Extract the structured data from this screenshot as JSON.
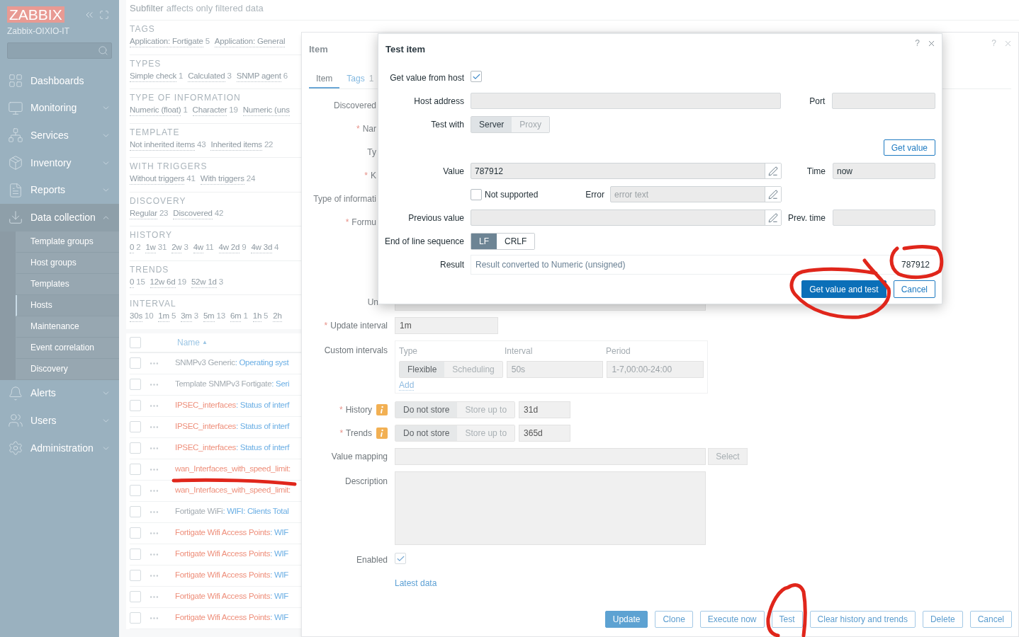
{
  "sidebar": {
    "logo": "ZABBIX",
    "server": "Zabbix-OIXIO-IT",
    "menu": [
      {
        "label": "Dashboards"
      },
      {
        "label": "Monitoring",
        "expanded": false
      },
      {
        "label": "Services",
        "expanded": false
      },
      {
        "label": "Inventory",
        "expanded": false
      },
      {
        "label": "Reports",
        "expanded": false
      },
      {
        "label": "Data collection",
        "expanded": true,
        "children": [
          {
            "label": "Template groups",
            "selected": false
          },
          {
            "label": "Host groups",
            "selected": false
          },
          {
            "label": "Templates",
            "selected": false
          },
          {
            "label": "Hosts",
            "selected": true
          },
          {
            "label": "Maintenance",
            "selected": false
          },
          {
            "label": "Event correlation",
            "selected": false
          },
          {
            "label": "Discovery",
            "selected": false
          }
        ]
      },
      {
        "label": "Alerts",
        "expanded": false
      },
      {
        "label": "Users",
        "expanded": false
      },
      {
        "label": "Administration",
        "expanded": false
      }
    ]
  },
  "subfilter": {
    "label": "Subfilter",
    "note": "affects only filtered data",
    "groups": [
      {
        "title": "TAGS",
        "items": [
          {
            "label": "Application: Fortigate",
            "count": "5"
          },
          {
            "label": "Application: General"
          }
        ]
      },
      {
        "title": "TYPES",
        "items": [
          {
            "label": "Simple check",
            "count": "1"
          },
          {
            "label": "Calculated",
            "count": "3"
          },
          {
            "label": "SNMP agent",
            "count": "6"
          }
        ]
      },
      {
        "title": "TYPE OF INFORMATION",
        "items": [
          {
            "label": "Numeric (float)",
            "count": "1"
          },
          {
            "label": "Character",
            "count": "19"
          },
          {
            "label": "Numeric (uns"
          }
        ]
      },
      {
        "title": "TEMPLATE",
        "items": [
          {
            "label": "Not inherited items",
            "count": "43"
          },
          {
            "label": "Inherited items",
            "count": "22"
          }
        ]
      },
      {
        "title": "WITH TRIGGERS",
        "items": [
          {
            "label": "Without triggers",
            "count": "41"
          },
          {
            "label": "With triggers",
            "count": "24"
          }
        ]
      },
      {
        "title": "DISCOVERY",
        "items": [
          {
            "label": "Regular",
            "count": "23"
          },
          {
            "label": "Discovered",
            "count": "42"
          }
        ]
      },
      {
        "title": "HISTORY",
        "items": [
          {
            "label": "0",
            "count": "2"
          },
          {
            "label": "1w",
            "count": "31"
          },
          {
            "label": "2w",
            "count": "3"
          },
          {
            "label": "4w",
            "count": "11"
          },
          {
            "label": "4w 2d",
            "count": "9"
          },
          {
            "label": "4w 3d",
            "count": "4"
          }
        ]
      },
      {
        "title": "TRENDS",
        "items": [
          {
            "label": "0",
            "count": "15"
          },
          {
            "label": "12w 6d",
            "count": "19"
          },
          {
            "label": "52w 1d",
            "count": "3"
          }
        ]
      },
      {
        "title": "INTERVAL",
        "items": [
          {
            "label": "30s",
            "count": "10"
          },
          {
            "label": "1m",
            "count": "5"
          },
          {
            "label": "3m",
            "count": "3"
          },
          {
            "label": "5m",
            "count": "13"
          },
          {
            "label": "6m",
            "count": "1"
          },
          {
            "label": "1h",
            "count": "5"
          },
          {
            "label": "2h"
          }
        ]
      }
    ]
  },
  "items_table": {
    "header": {
      "label": "Name",
      "sort_mark": "▲",
      "checked": false
    },
    "rows": [
      {
        "kind": "template",
        "host": "SNMPv3 Generic",
        "name": ": Operating syst",
        "checked": false
      },
      {
        "kind": "template",
        "host": "Template SNMPv3 Fortigate",
        "name": ": Seri",
        "checked": false
      },
      {
        "kind": "discovered",
        "host": "IPSEC_interfaces",
        "name": ": Status of interf",
        "checked": false
      },
      {
        "kind": "discovered",
        "host": "IPSEC_interfaces",
        "name": ": Status of interf",
        "checked": false
      },
      {
        "kind": "discovered",
        "host": "IPSEC_interfaces",
        "name": ": Status of interf",
        "checked": false
      },
      {
        "kind": "discovered",
        "host": "wan_Interfaces_with_speed_limit:",
        "checked": false
      },
      {
        "kind": "discovered",
        "host": "wan_Interfaces_with_speed_limit:",
        "checked": false
      },
      {
        "kind": "template",
        "host": "Fortigate WiFi",
        "name": ": WIFI: Clients Total",
        "checked": false
      },
      {
        "kind": "discovered",
        "host": "Fortigate Wifi Access Points",
        "name": ": WIF",
        "checked": false
      },
      {
        "kind": "discovered",
        "host": "Fortigate Wifi Access Points",
        "name": ": WIF",
        "checked": false
      },
      {
        "kind": "discovered",
        "host": "Fortigate Wifi Access Points",
        "name": ": WIF",
        "checked": false
      },
      {
        "kind": "discovered",
        "host": "Fortigate Wifi Access Points",
        "name": ": WIF",
        "checked": false
      },
      {
        "kind": "discovered",
        "host": "Fortigate Wifi Access Points",
        "name": ": WIF",
        "checked": false
      }
    ]
  },
  "item_dialog": {
    "title": "Item",
    "help": "?",
    "required_mark": "*",
    "tabs": [
      {
        "label": "Item",
        "selected": true
      },
      {
        "label": "Tags",
        "count": "1",
        "selected": false
      }
    ],
    "covered_rows": [
      {
        "label": "Discovered",
        "required": false
      },
      {
        "label": "Nar",
        "required": true
      },
      {
        "label": "Ty",
        "required": false
      },
      {
        "label": "K",
        "required": true
      },
      {
        "label": "Type of informati",
        "required": false
      },
      {
        "label": "Formu",
        "required": true
      }
    ],
    "units_label": "Un",
    "update_interval": {
      "label": "Update interval",
      "required": true,
      "value": "1m"
    },
    "custom_intervals": {
      "label": "Custom intervals",
      "columns": [
        "Type",
        "Interval",
        "Period"
      ],
      "type_options": [
        {
          "label": "Flexible",
          "selected": true
        },
        {
          "label": "Scheduling",
          "selected": false
        }
      ],
      "interval": "50s",
      "period": "1-7,00:00-24:00",
      "add": "Add"
    },
    "history": {
      "label": "History",
      "required": true,
      "options": [
        {
          "label": "Do not store",
          "selected": true
        },
        {
          "label": "Store up to",
          "selected": false
        }
      ],
      "value": "31d"
    },
    "trends": {
      "label": "Trends",
      "required": true,
      "options": [
        {
          "label": "Do not store",
          "selected": true
        },
        {
          "label": "Store up to",
          "selected": false
        }
      ],
      "value": "365d"
    },
    "value_mapping": {
      "label": "Value mapping",
      "button": "Select"
    },
    "description": {
      "label": "Description"
    },
    "enabled": {
      "label": "Enabled",
      "checked": true
    },
    "latest_data": "Latest data",
    "buttons": [
      {
        "label": "Update",
        "primary": true
      },
      {
        "label": "Clone",
        "primary": false
      },
      {
        "label": "Execute now",
        "primary": false
      },
      {
        "label": "Test",
        "primary": false
      },
      {
        "label": "Clear history and trends",
        "primary": false
      },
      {
        "label": "Delete",
        "primary": false
      },
      {
        "label": "Cancel",
        "primary": false
      }
    ]
  },
  "test_dialog": {
    "title": "Test item",
    "help": "?",
    "get_value_from_host": {
      "label": "Get value from host",
      "checked": true
    },
    "host_address": {
      "label": "Host address"
    },
    "port": {
      "label": "Port"
    },
    "test_with": {
      "label": "Test with",
      "options": [
        {
          "label": "Server",
          "selected": true
        },
        {
          "label": "Proxy",
          "selected": false
        }
      ]
    },
    "get_value_button": "Get value",
    "value": {
      "label": "Value",
      "value": "787912"
    },
    "time": {
      "label": "Time",
      "value": "now"
    },
    "not_supported": {
      "label": "Not supported",
      "checked": false
    },
    "error": {
      "label": "Error",
      "placeholder": "error text"
    },
    "previous_value": {
      "label": "Previous value"
    },
    "prev_time": {
      "label": "Prev. time"
    },
    "eol": {
      "label": "End of line sequence",
      "options": [
        {
          "label": "LF",
          "selected": true
        },
        {
          "label": "CRLF",
          "selected": false
        }
      ]
    },
    "result": {
      "label": "Result",
      "note": "Result converted to Numeric (unsigned)",
      "value": "787912"
    },
    "buttons": [
      {
        "label": "Get value and test",
        "primary": true
      },
      {
        "label": "Cancel",
        "primary": false
      }
    ]
  }
}
